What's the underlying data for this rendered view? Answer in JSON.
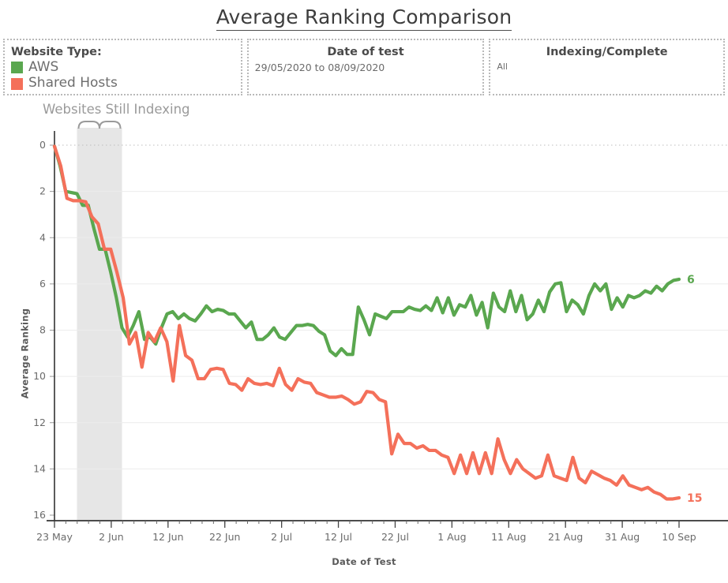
{
  "title": "Average Ranking Comparison",
  "filters": {
    "legend": {
      "heading": "Website Type:",
      "items": [
        {
          "label": "AWS",
          "color": "#5aa74f"
        },
        {
          "label": "Shared Hosts",
          "color": "#f4705a"
        }
      ]
    },
    "date": {
      "heading": "Date of test",
      "value": "29/05/2020 to 08/09/2020"
    },
    "indexing": {
      "heading": "Indexing/Complete",
      "value": "All"
    }
  },
  "annotation": "Websites Still Indexing",
  "chart_data": {
    "type": "line",
    "title": "Average Ranking Comparison",
    "xlabel": "Date of Test",
    "ylabel": "Average Ranking",
    "y_inverted": true,
    "ylim": [
      0,
      16
    ],
    "yticks": [
      0,
      2,
      4,
      6,
      8,
      10,
      12,
      14,
      16
    ],
    "xticks": [
      "23 May",
      "2 Jun",
      "12 Jun",
      "22 Jun",
      "2 Jul",
      "12 Jul",
      "22 Jul",
      "1 Aug",
      "11 Aug",
      "21 Aug",
      "31 Aug",
      "10 Sep"
    ],
    "x_start": "29/05/2020",
    "x_end": "08/09/2020",
    "grid": true,
    "legend_position": "top-left",
    "shaded_region": {
      "label": "Websites Still Indexing",
      "x_start_day": 4,
      "x_end_day": 12,
      "color": "#e6e6e6"
    },
    "end_labels": [
      {
        "series": "AWS",
        "value": "6",
        "color": "#5aa74f"
      },
      {
        "series": "Shared Hosts",
        "value": "15",
        "color": "#f4705a"
      }
    ],
    "series": [
      {
        "name": "AWS",
        "color": "#5aa74f",
        "values": [
          0.05,
          0.9,
          2.0,
          2.05,
          2.1,
          2.6,
          2.6,
          3.6,
          4.5,
          4.5,
          5.5,
          6.6,
          7.9,
          8.3,
          7.8,
          7.2,
          8.4,
          8.3,
          8.6,
          7.9,
          7.3,
          7.2,
          7.5,
          7.3,
          7.5,
          7.6,
          7.3,
          6.95,
          7.2,
          7.1,
          7.15,
          7.3,
          7.3,
          7.6,
          7.9,
          7.65,
          8.4,
          8.4,
          8.2,
          7.9,
          8.3,
          8.4,
          8.1,
          7.8,
          7.8,
          7.75,
          7.8,
          8.05,
          8.2,
          8.9,
          9.1,
          8.8,
          9.05,
          9.05,
          7.0,
          7.55,
          8.2,
          7.3,
          7.4,
          7.5,
          7.2,
          7.2,
          7.2,
          7.0,
          7.1,
          7.15,
          6.95,
          7.15,
          6.6,
          7.25,
          6.6,
          7.35,
          6.9,
          7.0,
          6.5,
          7.35,
          6.8,
          7.9,
          6.4,
          7.0,
          7.2,
          6.3,
          7.2,
          6.5,
          7.55,
          7.3,
          6.7,
          7.2,
          6.35,
          6.0,
          5.95,
          7.2,
          6.7,
          6.9,
          7.3,
          6.5,
          6.0,
          6.3,
          6.0,
          7.1,
          6.6,
          7.0,
          6.5,
          6.6,
          6.5,
          6.3,
          6.4,
          6.1,
          6.3,
          6.0,
          5.85,
          5.8
        ]
      },
      {
        "name": "Shared Hosts",
        "color": "#f4705a",
        "values": [
          0.05,
          0.9,
          2.3,
          2.4,
          2.4,
          2.45,
          3.1,
          3.4,
          4.5,
          4.5,
          5.5,
          6.6,
          8.6,
          8.1,
          9.6,
          8.1,
          8.5,
          7.9,
          8.5,
          10.2,
          7.8,
          9.1,
          9.3,
          10.1,
          10.1,
          9.7,
          9.65,
          9.7,
          10.3,
          10.35,
          10.6,
          10.1,
          10.3,
          10.35,
          10.3,
          10.4,
          9.65,
          10.35,
          10.6,
          10.1,
          10.25,
          10.3,
          10.7,
          10.8,
          10.9,
          10.9,
          10.85,
          11.0,
          11.2,
          11.1,
          10.65,
          10.7,
          11.0,
          11.1,
          13.35,
          12.5,
          12.9,
          12.9,
          13.1,
          13.0,
          13.2,
          13.2,
          13.4,
          13.5,
          14.2,
          13.4,
          14.2,
          13.3,
          14.2,
          13.3,
          14.2,
          12.7,
          13.6,
          14.2,
          13.6,
          14.0,
          14.2,
          14.4,
          14.3,
          13.4,
          14.3,
          14.4,
          14.5,
          13.5,
          14.4,
          14.6,
          14.1,
          14.25,
          14.4,
          14.5,
          14.7,
          14.3,
          14.7,
          14.8,
          14.9,
          14.8,
          15.0,
          15.1,
          15.3,
          15.3,
          15.25
        ]
      }
    ]
  }
}
